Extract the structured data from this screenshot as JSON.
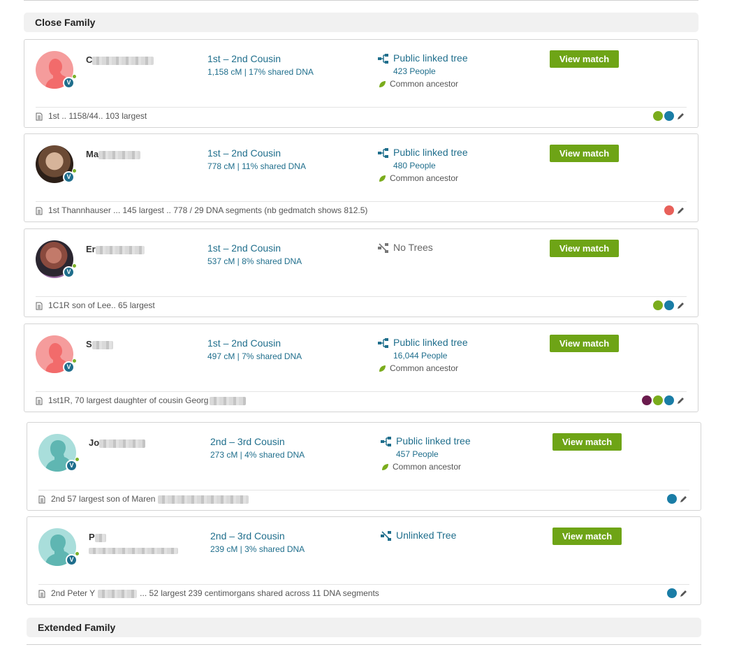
{
  "sections": {
    "close_family": "Close Family",
    "extended_family": "Extended Family"
  },
  "view_label": "View match",
  "badge_letter": "V",
  "matches": [
    {
      "name_visible": "C",
      "relationship": "1st – 2nd Cousin",
      "shared": "1,158 cM | 17% shared DNA",
      "tree_label": "Public linked tree",
      "tree_type": "public",
      "people": "423 People",
      "ancestor": "Common ancestor",
      "note": "1st .. 1158/44.. 103 largest",
      "note_tail": "",
      "dots": [
        "#7aac1c",
        "#1a7da6"
      ]
    },
    {
      "name_visible": "Ma",
      "relationship": "1st – 2nd Cousin",
      "shared": "778 cM | 11% shared DNA",
      "tree_label": "Public linked tree",
      "tree_type": "public",
      "people": "480 People",
      "ancestor": "Common ancestor",
      "note": "1st Thannhauser ... 145 largest .. 778 / 29 DNA segments (nb gedmatch shows 812.5)",
      "note_tail": "",
      "dots": [
        "#e8605a"
      ]
    },
    {
      "name_visible": "Er",
      "relationship": "1st – 2nd Cousin",
      "shared": "537 cM | 8% shared DNA",
      "tree_label": "No Trees",
      "tree_type": "none",
      "people": "",
      "ancestor": "",
      "note": "1C1R son of Lee.. 65 largest",
      "note_tail": "",
      "dots": [
        "#7aac1c",
        "#1a7da6"
      ]
    },
    {
      "name_visible": "S",
      "relationship": "1st – 2nd Cousin",
      "shared": "497 cM | 7% shared DNA",
      "tree_label": "Public linked tree",
      "tree_type": "public",
      "people": "16,044 People",
      "ancestor": "Common ancestor",
      "note": "1st1R, 70 largest daughter of cousin Georg",
      "note_tail": "",
      "dots": [
        "#6a1b4d",
        "#7aac1c",
        "#1a7da6"
      ]
    },
    {
      "name_visible": "Jo",
      "relationship": "2nd – 3rd Cousin",
      "shared": "273 cM | 4% shared DNA",
      "tree_label": "Public linked tree",
      "tree_type": "public",
      "people": "457 People",
      "ancestor": "Common ancestor",
      "note": "2nd 57 largest son of Maren",
      "note_tail": "",
      "dots": [
        "#1a7da6"
      ]
    },
    {
      "name_visible": "P",
      "relationship": "2nd – 3rd Cousin",
      "shared": "239 cM | 3% shared DNA",
      "tree_label": "Unlinked Tree",
      "tree_type": "unlinked",
      "people": "",
      "ancestor": "",
      "note": "2nd Peter Y",
      "note_tail": "... 52 largest 239 centimorgans shared across 11 DNA segments",
      "dots": [
        "#1a7da6"
      ]
    }
  ],
  "colors": {
    "accent": "#1f6e8c",
    "button": "#6ea416",
    "avatar_female": "#f59c9c",
    "avatar_male": "#7ccac7"
  }
}
